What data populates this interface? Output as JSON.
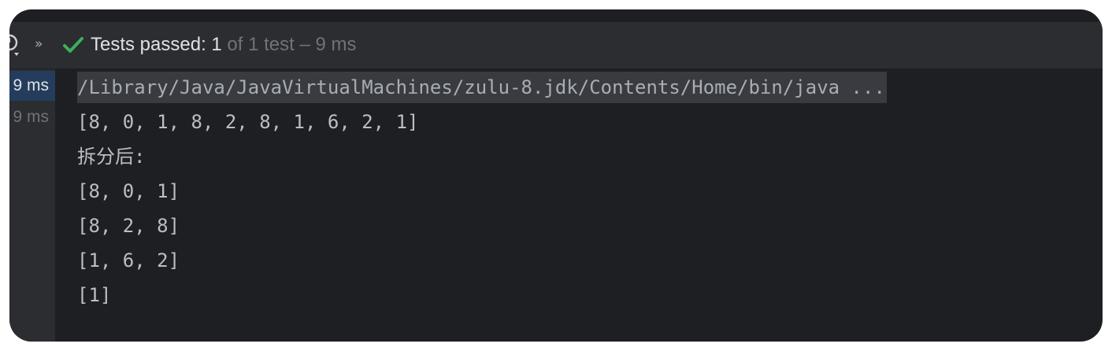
{
  "toolbar": {
    "status_strong": "Tests passed: 1",
    "status_muted": " of 1 test – 9 ms",
    "chevrons": "»",
    "icons": [
      "run-history-icon",
      "chevrons-icon",
      "check-icon"
    ],
    "check_color": "#3eaf5a"
  },
  "durations": [
    {
      "label": "9 ms",
      "selected": true
    },
    {
      "label": "9 ms",
      "selected": false
    }
  ],
  "console": {
    "command": "/Library/Java/JavaVirtualMachines/zulu-8.jdk/Contents/Home/bin/java ...",
    "lines": [
      "[8, 0, 1, 8, 2, 8, 1, 6, 2, 1]",
      "拆分后:",
      "[8, 0, 1]",
      "[8, 2, 8]",
      "[1, 6, 2]",
      "[1]"
    ]
  }
}
